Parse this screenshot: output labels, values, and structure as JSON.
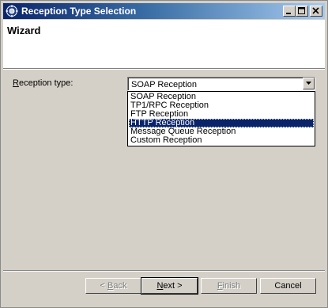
{
  "window": {
    "title": "Reception Type Selection",
    "buttons": {
      "minimize": "minimize-icon",
      "maximize": "maximize-icon",
      "close": "close-icon"
    }
  },
  "banner": {
    "title": "Wizard"
  },
  "form": {
    "label_accel": "R",
    "label_rest": "eception type:",
    "selected_value": "SOAP Reception",
    "options": [
      "SOAP Reception",
      "TP1/RPC Reception",
      "FTP Reception",
      "HTTP Reception",
      "Message Queue Reception",
      "Custom Reception"
    ],
    "highlighted_option": "HTTP Reception"
  },
  "footer": {
    "back": {
      "prefix": "< ",
      "accel": "B",
      "rest": "ack",
      "enabled": false
    },
    "next": {
      "accel": "N",
      "rest": "ext >",
      "enabled": true
    },
    "finish": {
      "accel": "F",
      "rest": "inish",
      "enabled": false
    },
    "cancel": {
      "label": "Cancel",
      "enabled": true
    }
  },
  "colors": {
    "title_gradient_start": "#0a246a",
    "title_gradient_end": "#a6caf0",
    "selection": "#0a246a",
    "dialog_face": "#d4d0c8"
  }
}
